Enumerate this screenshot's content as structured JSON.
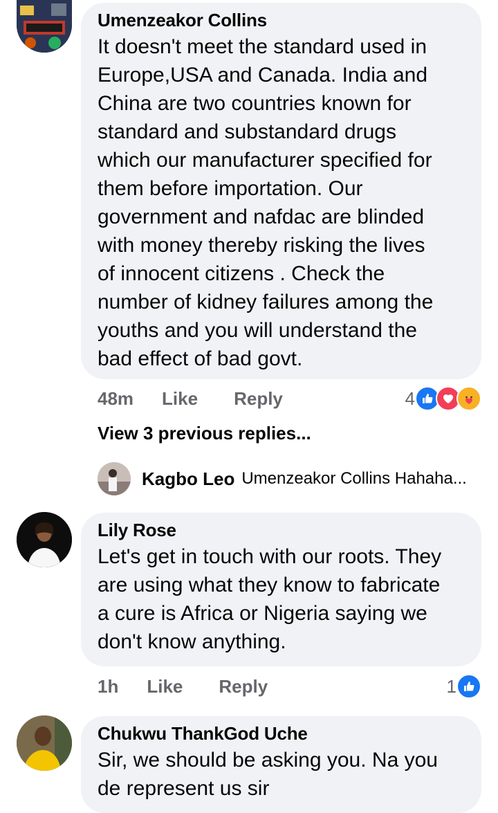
{
  "comments": [
    {
      "author": "Umenzeakor Collins",
      "text": "It doesn't meet the standard used in\nEurope,USA and Canada. India and\nChina are two countries known for\nstandard and substandard drugs\nwhich our manufacturer specified for\nthem before importation. Our\ngovernment and nafdac are blinded\nwith money thereby risking the lives\nof innocent citizens . Check the\nnumber of kidney failures among the\nyouths and you will understand the\nbad effect of bad govt.",
      "time": "48m",
      "like_label": "Like",
      "reply_label": "Reply",
      "reaction_count": "4",
      "reactions": [
        "like-icon",
        "love-icon",
        "care-icon"
      ]
    },
    {
      "author": "Lily Rose",
      "text": "Let's get in touch with our roots. They\nare using what they know to fabricate\na cure is Africa or Nigeria saying we\ndon't know anything.",
      "time": "1h",
      "like_label": "Like",
      "reply_label": "Reply",
      "reaction_count": "1",
      "reactions": [
        "like-icon"
      ]
    },
    {
      "author": "Chukwu ThankGod Uche",
      "text": "Sir, we should be asking you. Na you\nde represent us sir"
    }
  ],
  "replies_section": {
    "view_previous": "View 3 previous replies...",
    "latest_reply_author": "Kagbo Leo",
    "latest_reply_snippet": "Umenzeakor Collins Hahaha..."
  },
  "colors": {
    "bubble": "#f0f2f5",
    "meta_text": "#65676b",
    "like_blue": "#1877f2",
    "love_red": "#f33e58",
    "care_yellow": "#f7b125"
  }
}
